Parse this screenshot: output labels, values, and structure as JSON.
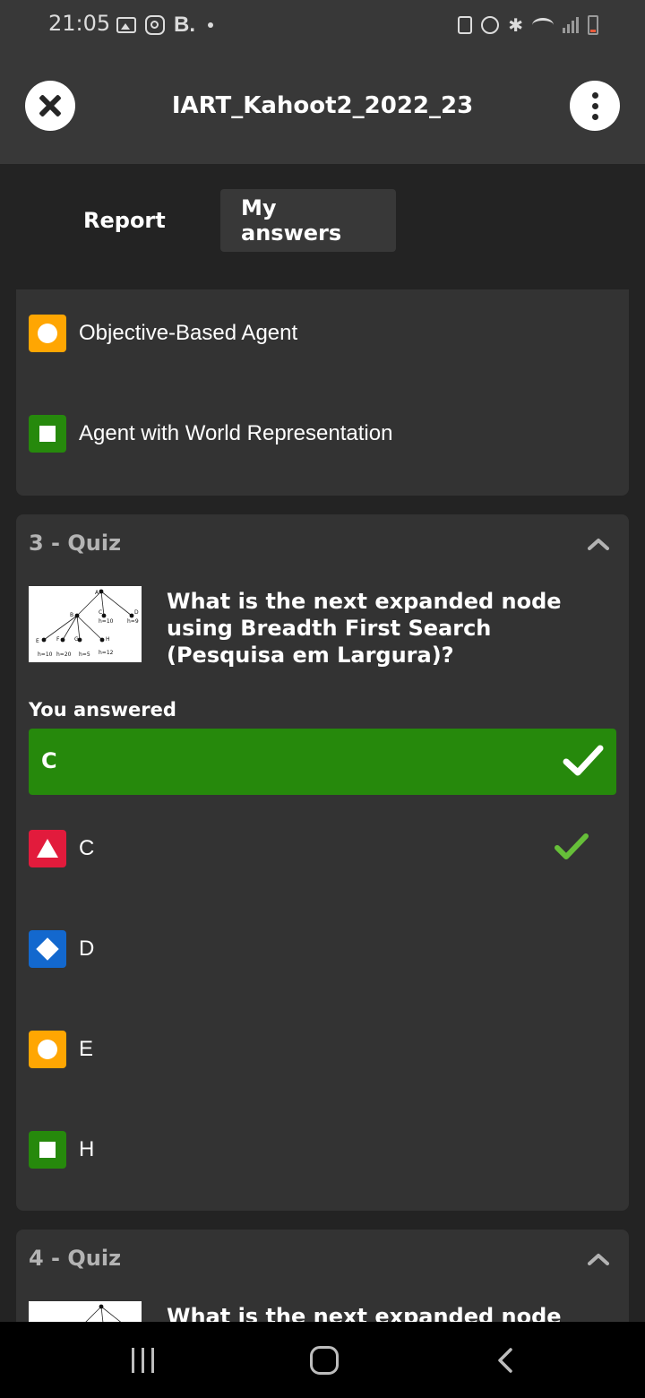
{
  "status_bar": {
    "time": "21:05",
    "left_icons": [
      "gallery-icon",
      "instagram-icon",
      "b-app-icon",
      "notification-dot"
    ],
    "b_label": "B.",
    "right_icons": [
      "lock-icon",
      "alarm-icon",
      "bluetooth-icon",
      "wifi-icon",
      "signal-icon",
      "battery-icon"
    ],
    "bluetooth_glyph": "✱"
  },
  "header": {
    "title": "IART_Kahoot2_2022_23",
    "close_icon": "close-icon",
    "menu_icon": "more-vertical-icon"
  },
  "tabs": [
    {
      "label": "Report",
      "active": false
    },
    {
      "label": "My answers",
      "active": true
    }
  ],
  "colors": {
    "triangle": "#e21b3c",
    "diamond": "#1368ce",
    "circle": "#ffa602",
    "square": "#26890c",
    "correct_check": "#66bf39"
  },
  "previous_question": {
    "options": [
      {
        "shape": "circle",
        "label": "Objective-Based Agent"
      },
      {
        "shape": "square",
        "label": "Agent with World Representation"
      }
    ]
  },
  "questions": [
    {
      "title": "3 - Quiz",
      "text": "What is the next expanded node using Breadth First Search (Pesquisa em Largura)?",
      "you_answered_label": "You answered",
      "your_answer": "C",
      "your_answer_correct": true,
      "options": [
        {
          "shape": "triangle",
          "label": "C",
          "correct": true
        },
        {
          "shape": "diamond",
          "label": "D",
          "correct": false
        },
        {
          "shape": "circle",
          "label": "E",
          "correct": false
        },
        {
          "shape": "square",
          "label": "H",
          "correct": false
        }
      ],
      "thumbnail": {
        "nodes": [
          "A",
          "B",
          "C",
          "D",
          "E",
          "F",
          "G",
          "H"
        ],
        "heuristics": [
          "h=10",
          "h=20",
          "h=5",
          "h=12",
          "h=10",
          "h=9"
        ]
      }
    },
    {
      "title": "4 - Quiz",
      "text": "What is the next expanded node"
    }
  ],
  "nav_bar": {
    "buttons": [
      "recent-apps-icon",
      "home-icon",
      "back-icon"
    ]
  }
}
